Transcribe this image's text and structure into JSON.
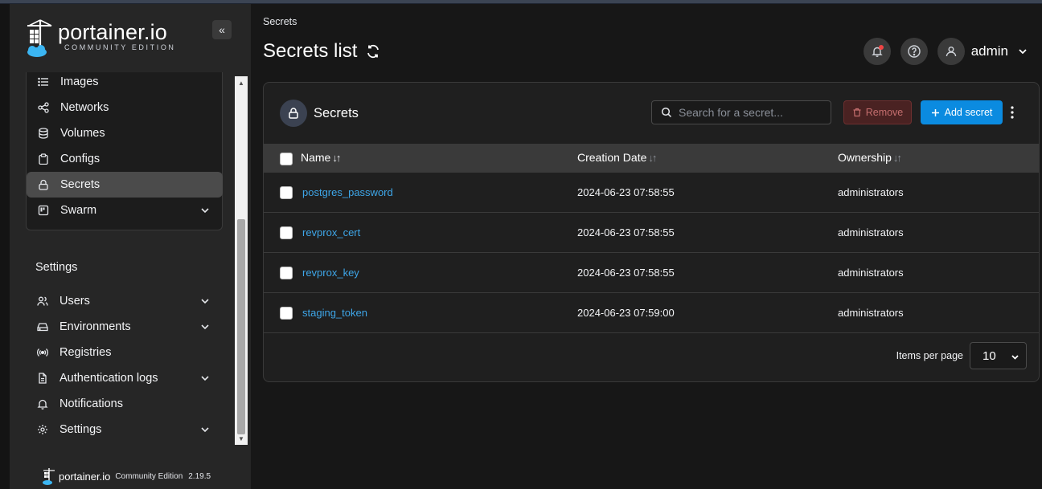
{
  "brand": {
    "name": "portainer.io",
    "edition": "COMMUNITY EDITION"
  },
  "sidebar": {
    "collapse_glyph": "«",
    "swarm_items": [
      {
        "label": "Images",
        "icon": "list-icon"
      },
      {
        "label": "Networks",
        "icon": "share-icon"
      },
      {
        "label": "Volumes",
        "icon": "database-icon"
      },
      {
        "label": "Configs",
        "icon": "clipboard-icon"
      },
      {
        "label": "Secrets",
        "icon": "lock-icon",
        "active": true
      },
      {
        "label": "Swarm",
        "icon": "board-icon",
        "expandable": true
      }
    ],
    "settings_heading": "Settings",
    "settings_items": [
      {
        "label": "Users",
        "icon": "users-icon",
        "expandable": true
      },
      {
        "label": "Environments",
        "icon": "hard-drive-icon",
        "expandable": true
      },
      {
        "label": "Registries",
        "icon": "radio-icon"
      },
      {
        "label": "Authentication logs",
        "icon": "file-text-icon",
        "expandable": true
      },
      {
        "label": "Notifications",
        "icon": "bell-icon"
      },
      {
        "label": "Settings",
        "icon": "gear-icon",
        "expandable": true
      }
    ],
    "footer": {
      "name": "portainer.io",
      "edition": "Community Edition",
      "version": "2.19.5"
    }
  },
  "header": {
    "breadcrumb": "Secrets",
    "title": "Secrets list",
    "user": "admin"
  },
  "card": {
    "title": "Secrets",
    "search_placeholder": "Search for a secret...",
    "remove_label": "Remove",
    "add_label": "Add secret",
    "columns": [
      {
        "label": "Name",
        "sort": "↓↑"
      },
      {
        "label": "Creation Date",
        "sort": "↓↑"
      },
      {
        "label": "Ownership",
        "sort": "↓↑"
      }
    ],
    "rows": [
      {
        "name": "postgres_password",
        "created": "2024-06-23 07:58:55",
        "ownership": "administrators"
      },
      {
        "name": "revprox_cert",
        "created": "2024-06-23 07:58:55",
        "ownership": "administrators"
      },
      {
        "name": "revprox_key",
        "created": "2024-06-23 07:58:55",
        "ownership": "administrators"
      },
      {
        "name": "staging_token",
        "created": "2024-06-23 07:59:00",
        "ownership": "administrators"
      }
    ],
    "pager_label": "Items per page",
    "pager_value": "10"
  },
  "colors": {
    "accent": "#0b8be0",
    "link": "#3ea6e8",
    "danger": "#c46e6e"
  }
}
